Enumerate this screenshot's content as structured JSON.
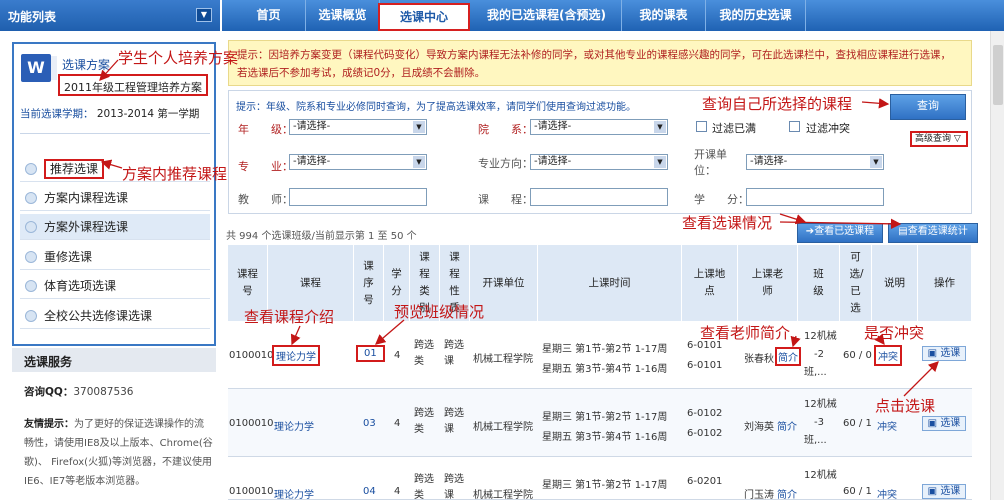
{
  "sidebar_title": "功能列表",
  "nav": {
    "tabs": [
      "首页",
      "选课概览",
      "选课中心",
      "我的已选课程(含预选)",
      "我的课表",
      "我的历史选课"
    ],
    "active": 2
  },
  "plan": {
    "title": "选课方案",
    "name": "2011年级工程管理培养方案",
    "term_label": "当前选课学期：",
    "term_value": "2013-2014 第一学期"
  },
  "sidebar": {
    "items": [
      "推荐选课",
      "方案内课程选课",
      "方案外课程选课",
      "重修选课",
      "体育选项选课",
      "全校公共选修课选课"
    ]
  },
  "service": {
    "title": "选课服务",
    "qq_label": "咨询QQ：",
    "qq_value": "370087536",
    "tip_label": "友情提示：",
    "tip_lines": [
      "为了更好的保证选课操作的流",
      "畅性，请使用IE8及以上版本、Chrome(谷",
      "歌)、 Firefox(火狐)等浏览器，不建议使用",
      "IE6、IE7等老版本浏览器。"
    ]
  },
  "notice": {
    "line1": "提示：因培养方案变更（课程代码变化）导致方案内课程无法补修的同学，或对其他专业的课程感兴趣的同学，可在此选课栏中，查找相应课程进行选课，",
    "line2": "若选课后不参加考试，成绩记0分，且成绩不会删除。"
  },
  "filter": {
    "hint": "提示：年级、院系和专业必修同时查询，为了提高选课效率，请同学们使用查询过滤功能。",
    "grade_label": "年　　级：",
    "dept_label": "院　　系：",
    "major_label": "专　　业：",
    "direction_label": "专业方向：",
    "unit_label_1": "开课单",
    "unit_label_2": "位：",
    "teacher_label": "教　　师：",
    "course_label": "课　　程：",
    "credit_label": "学　　分：",
    "placeholder_select": "-请选择-",
    "filter_full": "过滤已满",
    "filter_conflict": "过滤冲突",
    "search_button": "查询",
    "advanced": "高级查询"
  },
  "actions": {
    "view_selected": "查看已选课程",
    "view_stats": "查看选课统计"
  },
  "count_text": "共 994 个选课班级/当前显示第 1 至 50 个",
  "table": {
    "headers": [
      "课程号",
      "课程",
      "课序号",
      "学分",
      "课程类别",
      "课程性质",
      "开课单位",
      "上课时间",
      "上课地点",
      "上课老师",
      "班级",
      "可选/已选",
      "说明",
      "操作"
    ],
    "rows": [
      {
        "code": "0100010",
        "course": "理论力学",
        "seq": "01",
        "credit": "4",
        "category": "跨选类",
        "nature": "跨选课",
        "unit": "机械工程学院",
        "time1": "星期三 第1节-第2节 1-17周",
        "time2": "星期五 第3节-第4节 1-16周",
        "place1": "6-0101",
        "place2": "6-0101",
        "teacher": "张春秋",
        "intro": "简介",
        "class1": "12机械",
        "class2": "-2",
        "class3": "班,...",
        "quota": "60 / 0",
        "note": "冲突",
        "op": "选课"
      },
      {
        "code": "0100010",
        "course": "理论力学",
        "seq": "03",
        "credit": "4",
        "category": "跨选类",
        "nature": "跨选课",
        "unit": "机械工程学院",
        "time1": "星期三 第1节-第2节 1-17周",
        "time2": "星期五 第3节-第4节 1-16周",
        "place1": "6-0102",
        "place2": "6-0102",
        "teacher": "刘海英",
        "intro": "简介",
        "class1": "12机械",
        "class2": "-3",
        "class3": "班,...",
        "quota": "60 / 1",
        "note": "冲突",
        "op": "选课"
      },
      {
        "code": "0100010",
        "course": "理论力学",
        "seq": "04",
        "credit": "4",
        "category": "跨选类",
        "nature": "跨选课",
        "unit": "机械工程学院",
        "time1": "星期三 第1节-第2节 1-17周",
        "time2": "",
        "place1": "6-0201",
        "place2": "",
        "teacher": "门玉涛",
        "intro": "简介",
        "class1": "12机械",
        "class2": "",
        "class3": "",
        "quota": "60 / 1",
        "note": "冲突",
        "op": "选课"
      }
    ]
  },
  "annotations": {
    "plan": "学生个人培养方案",
    "recommend": "方案内推荐课程",
    "search": "查询自己所选择的课程",
    "stats": "查看选课情况",
    "course_intro": "查看课程介绍",
    "class_preview": "预览班级情况",
    "teacher_intro": "查看老师简介",
    "conflict": "是否冲突",
    "click_select": "点击选课"
  }
}
